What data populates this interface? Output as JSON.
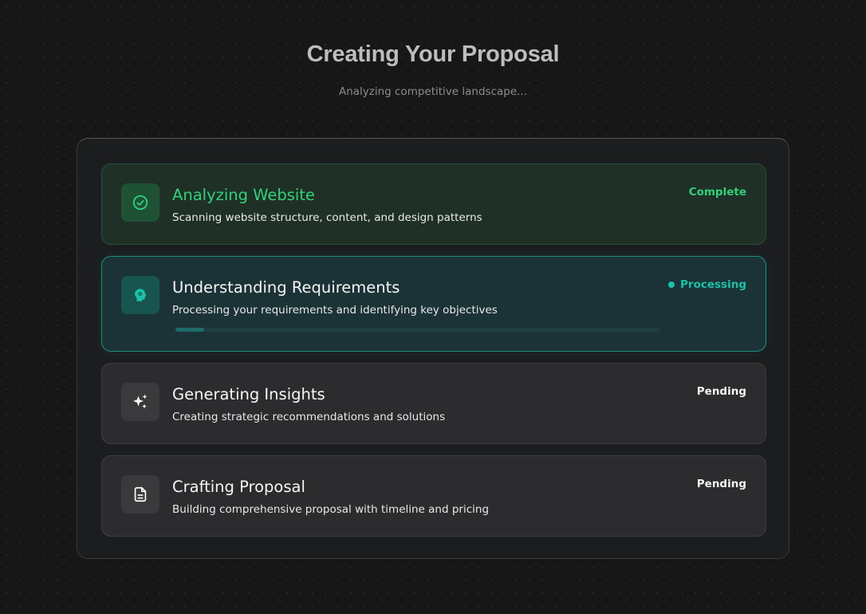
{
  "header": {
    "title": "Creating Your Proposal",
    "subtitle": "Analyzing competitive landscape..."
  },
  "colors": {
    "complete": "#2fd27a",
    "processing": "#19c3a9",
    "pending": "#f2f2f2"
  },
  "steps": [
    {
      "title": "Analyzing Website",
      "description": "Scanning website structure, content, and design patterns",
      "status": "Complete",
      "icon": "check-circle-icon"
    },
    {
      "title": "Understanding Requirements",
      "description": "Processing your requirements and identifying key objectives",
      "status": "Processing",
      "icon": "brain-gear-icon",
      "progress": 0.06
    },
    {
      "title": "Generating Insights",
      "description": "Creating strategic recommendations and solutions",
      "status": "Pending",
      "icon": "sparkles-icon"
    },
    {
      "title": "Crafting Proposal",
      "description": "Building comprehensive proposal with timeline and pricing",
      "status": "Pending",
      "icon": "document-icon"
    }
  ]
}
